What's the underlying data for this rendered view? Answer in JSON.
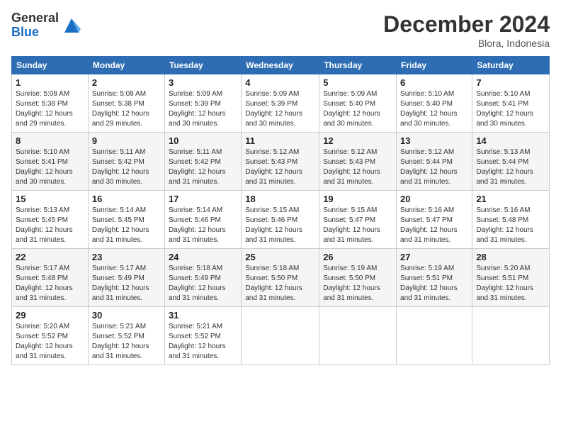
{
  "header": {
    "logo_line1": "General",
    "logo_line2": "Blue",
    "month": "December 2024",
    "location": "Blora, Indonesia"
  },
  "days_of_week": [
    "Sunday",
    "Monday",
    "Tuesday",
    "Wednesday",
    "Thursday",
    "Friday",
    "Saturday"
  ],
  "weeks": [
    [
      {
        "day": "1",
        "sunrise": "5:08 AM",
        "sunset": "5:38 PM",
        "daylight": "12 hours and 29 minutes."
      },
      {
        "day": "2",
        "sunrise": "5:08 AM",
        "sunset": "5:38 PM",
        "daylight": "12 hours and 29 minutes."
      },
      {
        "day": "3",
        "sunrise": "5:09 AM",
        "sunset": "5:39 PM",
        "daylight": "12 hours and 30 minutes."
      },
      {
        "day": "4",
        "sunrise": "5:09 AM",
        "sunset": "5:39 PM",
        "daylight": "12 hours and 30 minutes."
      },
      {
        "day": "5",
        "sunrise": "5:09 AM",
        "sunset": "5:40 PM",
        "daylight": "12 hours and 30 minutes."
      },
      {
        "day": "6",
        "sunrise": "5:10 AM",
        "sunset": "5:40 PM",
        "daylight": "12 hours and 30 minutes."
      },
      {
        "day": "7",
        "sunrise": "5:10 AM",
        "sunset": "5:41 PM",
        "daylight": "12 hours and 30 minutes."
      }
    ],
    [
      {
        "day": "8",
        "sunrise": "5:10 AM",
        "sunset": "5:41 PM",
        "daylight": "12 hours and 30 minutes."
      },
      {
        "day": "9",
        "sunrise": "5:11 AM",
        "sunset": "5:42 PM",
        "daylight": "12 hours and 30 minutes."
      },
      {
        "day": "10",
        "sunrise": "5:11 AM",
        "sunset": "5:42 PM",
        "daylight": "12 hours and 31 minutes."
      },
      {
        "day": "11",
        "sunrise": "5:12 AM",
        "sunset": "5:43 PM",
        "daylight": "12 hours and 31 minutes."
      },
      {
        "day": "12",
        "sunrise": "5:12 AM",
        "sunset": "5:43 PM",
        "daylight": "12 hours and 31 minutes."
      },
      {
        "day": "13",
        "sunrise": "5:12 AM",
        "sunset": "5:44 PM",
        "daylight": "12 hours and 31 minutes."
      },
      {
        "day": "14",
        "sunrise": "5:13 AM",
        "sunset": "5:44 PM",
        "daylight": "12 hours and 31 minutes."
      }
    ],
    [
      {
        "day": "15",
        "sunrise": "5:13 AM",
        "sunset": "5:45 PM",
        "daylight": "12 hours and 31 minutes."
      },
      {
        "day": "16",
        "sunrise": "5:14 AM",
        "sunset": "5:45 PM",
        "daylight": "12 hours and 31 minutes."
      },
      {
        "day": "17",
        "sunrise": "5:14 AM",
        "sunset": "5:46 PM",
        "daylight": "12 hours and 31 minutes."
      },
      {
        "day": "18",
        "sunrise": "5:15 AM",
        "sunset": "5:46 PM",
        "daylight": "12 hours and 31 minutes."
      },
      {
        "day": "19",
        "sunrise": "5:15 AM",
        "sunset": "5:47 PM",
        "daylight": "12 hours and 31 minutes."
      },
      {
        "day": "20",
        "sunrise": "5:16 AM",
        "sunset": "5:47 PM",
        "daylight": "12 hours and 31 minutes."
      },
      {
        "day": "21",
        "sunrise": "5:16 AM",
        "sunset": "5:48 PM",
        "daylight": "12 hours and 31 minutes."
      }
    ],
    [
      {
        "day": "22",
        "sunrise": "5:17 AM",
        "sunset": "5:48 PM",
        "daylight": "12 hours and 31 minutes."
      },
      {
        "day": "23",
        "sunrise": "5:17 AM",
        "sunset": "5:49 PM",
        "daylight": "12 hours and 31 minutes."
      },
      {
        "day": "24",
        "sunrise": "5:18 AM",
        "sunset": "5:49 PM",
        "daylight": "12 hours and 31 minutes."
      },
      {
        "day": "25",
        "sunrise": "5:18 AM",
        "sunset": "5:50 PM",
        "daylight": "12 hours and 31 minutes."
      },
      {
        "day": "26",
        "sunrise": "5:19 AM",
        "sunset": "5:50 PM",
        "daylight": "12 hours and 31 minutes."
      },
      {
        "day": "27",
        "sunrise": "5:19 AM",
        "sunset": "5:51 PM",
        "daylight": "12 hours and 31 minutes."
      },
      {
        "day": "28",
        "sunrise": "5:20 AM",
        "sunset": "5:51 PM",
        "daylight": "12 hours and 31 minutes."
      }
    ],
    [
      {
        "day": "29",
        "sunrise": "5:20 AM",
        "sunset": "5:52 PM",
        "daylight": "12 hours and 31 minutes."
      },
      {
        "day": "30",
        "sunrise": "5:21 AM",
        "sunset": "5:52 PM",
        "daylight": "12 hours and 31 minutes."
      },
      {
        "day": "31",
        "sunrise": "5:21 AM",
        "sunset": "5:52 PM",
        "daylight": "12 hours and 31 minutes."
      },
      null,
      null,
      null,
      null
    ]
  ]
}
